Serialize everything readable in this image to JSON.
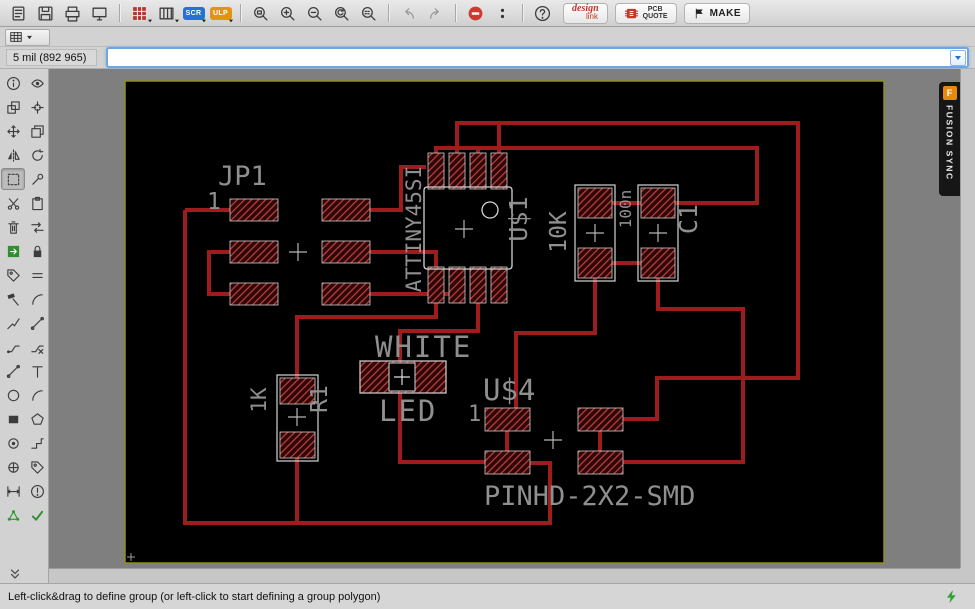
{
  "toolbar": {
    "items": [
      {
        "name": "open-board-button",
        "icon": "doc"
      },
      {
        "name": "save-button",
        "icon": "save"
      },
      {
        "name": "print-button",
        "icon": "print"
      },
      {
        "name": "cam-processor-button",
        "icon": "cam"
      },
      {
        "type": "sep"
      },
      {
        "name": "drc-rules-button",
        "icon": "drc",
        "caret": true
      },
      {
        "name": "library-manager-button",
        "icon": "bars",
        "caret": true
      },
      {
        "type": "badge",
        "name": "run-script-button",
        "label": "SCR",
        "color": "#2a6fd4",
        "caret": true
      },
      {
        "type": "badge",
        "name": "run-ulp-button",
        "label": "ULP",
        "color": "#e2930f",
        "caret": true
      },
      {
        "type": "sep"
      },
      {
        "name": "zoom-fit-button",
        "icon": "zoomfit"
      },
      {
        "name": "zoom-in-button",
        "icon": "zoomin"
      },
      {
        "name": "zoom-out-button",
        "icon": "zoomout"
      },
      {
        "name": "zoom-redraw-button",
        "icon": "zoomredraw"
      },
      {
        "name": "zoom-select-button",
        "icon": "zoomsel"
      },
      {
        "type": "sep"
      },
      {
        "name": "undo-button",
        "icon": "undo",
        "dim": true
      },
      {
        "name": "redo-button",
        "icon": "redo",
        "dim": true
      },
      {
        "type": "sep"
      },
      {
        "name": "stop-button",
        "icon": "stop"
      },
      {
        "name": "record-script-button",
        "icon": "dots"
      },
      {
        "type": "sep"
      },
      {
        "name": "help-button",
        "icon": "help"
      }
    ],
    "design_link_line1": "design",
    "design_link_line2": "link",
    "pcb_quote_line1": "PCB",
    "pcb_quote_line2": "QUOTE",
    "make_label": "MAKE"
  },
  "params_row": {
    "coords": "5 mil (892 965)",
    "command": {
      "value": "",
      "placeholder": ""
    }
  },
  "palette": {
    "active_tool": "group",
    "tools": [
      {
        "name": "info",
        "icon": "info"
      },
      {
        "name": "show",
        "icon": "eye"
      },
      {
        "name": "display",
        "icon": "layers"
      },
      {
        "name": "mark",
        "icon": "mark"
      },
      {
        "name": "move",
        "icon": "move"
      },
      {
        "name": "copy",
        "icon": "copy"
      },
      {
        "name": "mirror",
        "icon": "mirror"
      },
      {
        "name": "rotate",
        "icon": "rotate"
      },
      {
        "name": "group",
        "icon": "group"
      },
      {
        "name": "change",
        "icon": "change"
      },
      {
        "name": "cut",
        "icon": "cut"
      },
      {
        "name": "paste",
        "icon": "paste"
      },
      {
        "name": "delete",
        "icon": "delete"
      },
      {
        "name": "pinswap",
        "icon": "pinswap"
      },
      {
        "name": "replace",
        "icon": "replace"
      },
      {
        "name": "lock",
        "icon": "lock"
      },
      {
        "name": "name",
        "icon": "name"
      },
      {
        "name": "value",
        "icon": "value"
      },
      {
        "name": "smash",
        "icon": "smash"
      },
      {
        "name": "miter",
        "icon": "arc"
      },
      {
        "name": "split",
        "icon": "split"
      },
      {
        "name": "optimize",
        "icon": "wire"
      },
      {
        "name": "route",
        "icon": "route"
      },
      {
        "name": "ripup",
        "icon": "ripup"
      },
      {
        "name": "wire",
        "icon": "wire"
      },
      {
        "name": "text",
        "icon": "text"
      },
      {
        "name": "circle",
        "icon": "circle"
      },
      {
        "name": "arc",
        "icon": "arc"
      },
      {
        "name": "rect",
        "icon": "rect"
      },
      {
        "name": "polygon",
        "icon": "poly"
      },
      {
        "name": "via",
        "icon": "via"
      },
      {
        "name": "signal",
        "icon": "signal"
      },
      {
        "name": "hole",
        "icon": "hole"
      },
      {
        "name": "attribute",
        "icon": "name"
      },
      {
        "name": "dimension",
        "icon": "dim"
      },
      {
        "name": "errors",
        "icon": "err"
      },
      {
        "name": "ratsnest",
        "icon": "ratsnest"
      },
      {
        "name": "drc",
        "icon": "check"
      }
    ]
  },
  "fusion_sync": {
    "label": "FUSION SYNC",
    "logo_glyph": "F"
  },
  "board": {
    "jp1": {
      "name": "JP1",
      "pin": "1"
    },
    "u1": {
      "value": "ATTINY45SI",
      "name": "U$1"
    },
    "r2": {
      "value": "10K"
    },
    "c1": {
      "value": "100n",
      "name": "C1"
    },
    "led": {
      "label1": "WHITE",
      "label2": "LED"
    },
    "r1": {
      "value": "1K",
      "name": "R1"
    },
    "u4": {
      "name": "U$4",
      "pin": "1",
      "package": "PINHD-2X2-SMD"
    },
    "colors": {
      "trace": "#9e1c1c",
      "pad_hatch": "#bf4343",
      "silkscreen": "#d4d4d4",
      "label": "#8f8f8f",
      "board_outline": "#8f8f1a",
      "canvas_background": "#7f7f7f",
      "board_background": "#000000"
    }
  },
  "statusbar": {
    "message": "Left-click&drag to define group (or left-click to start defining a group polygon)"
  }
}
